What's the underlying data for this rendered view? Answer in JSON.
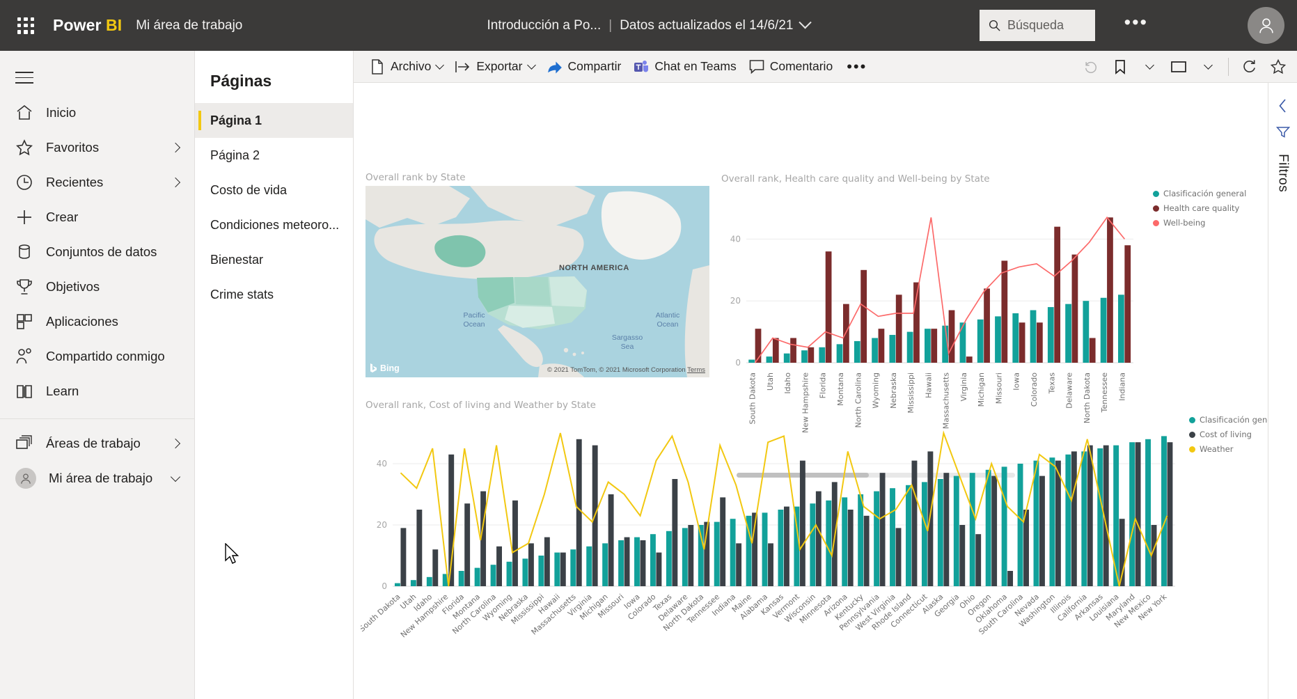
{
  "header": {
    "brand_power": "Power ",
    "brand_bi": "BI",
    "workspace": "Mi área de trabajo",
    "report_title": "Introducción a Po...",
    "separator": "|",
    "refresh_status": "Datos actualizados el 14/6/21",
    "search_placeholder": "Búsqueda",
    "more_options": "•••",
    "waffle_icon": "app-launcher-icon",
    "search_icon": "search-icon",
    "account_icon": "account-avatar-icon",
    "chevron_icon": "chevron-down-icon"
  },
  "sidebar": {
    "hamburger_icon": "hamburger-menu-icon",
    "items": [
      {
        "label": "Inicio",
        "icon": "home-icon",
        "expandable": false
      },
      {
        "label": "Favoritos",
        "icon": "star-icon",
        "expandable": true
      },
      {
        "label": "Recientes",
        "icon": "clock-icon",
        "expandable": true
      },
      {
        "label": "Crear",
        "icon": "plus-icon",
        "expandable": false
      },
      {
        "label": "Conjuntos de datos",
        "icon": "dataset-cylinder-icon",
        "expandable": false
      },
      {
        "label": "Objetivos",
        "icon": "trophy-icon",
        "expandable": false
      },
      {
        "label": "Aplicaciones",
        "icon": "apps-grid-icon",
        "expandable": false
      },
      {
        "label": "Compartido conmigo",
        "icon": "shared-people-icon",
        "expandable": false
      },
      {
        "label": "Learn",
        "icon": "book-icon",
        "expandable": false
      }
    ],
    "workspaces": [
      {
        "label": "Áreas de trabajo",
        "icon": "workspaces-stack-icon",
        "expandable": true
      },
      {
        "label": "Mi área de trabajo",
        "icon": "my-workspace-avatar-icon",
        "expandable": true
      }
    ]
  },
  "pages_pane": {
    "title": "Páginas",
    "collapse_icon": "double-chevron-left-icon",
    "pages": [
      {
        "label": "Página 1",
        "active": true
      },
      {
        "label": "Página 2",
        "active": false
      },
      {
        "label": "Costo de vida",
        "active": false
      },
      {
        "label": "Condiciones meteoro...",
        "active": false
      },
      {
        "label": "Bienestar",
        "active": false
      },
      {
        "label": "Crime stats",
        "active": false
      }
    ]
  },
  "toolbar": {
    "items": [
      {
        "label": "Archivo",
        "icon": "file-icon",
        "has_chevron": true
      },
      {
        "label": "Exportar",
        "icon": "export-arrow-icon",
        "has_chevron": true
      },
      {
        "label": "Compartir",
        "icon": "share-icon",
        "has_chevron": false
      },
      {
        "label": "Chat en Teams",
        "icon": "teams-icon",
        "has_chevron": false
      },
      {
        "label": "Comentario",
        "icon": "comment-bubble-icon",
        "has_chevron": false
      }
    ],
    "more_label": "•••",
    "right_icons": [
      {
        "name": "reset-icon",
        "has_chevron": false
      },
      {
        "name": "bookmark-icon",
        "has_chevron": true
      },
      {
        "name": "view-icon",
        "has_chevron": true
      },
      {
        "name": "refresh-icon",
        "has_chevron": false
      },
      {
        "name": "favorite-star-icon",
        "has_chevron": false
      }
    ]
  },
  "filters_pane": {
    "expand_icon": "chevron-left-icon",
    "filter_icon": "filter-funnel-icon",
    "label": "Filtros"
  },
  "map_visual": {
    "title": "Overall rank by State",
    "provider": "Bing",
    "provider_icon": "bing-logo-icon",
    "credit": "© 2021 TomTom, © 2021 Microsoft Corporation",
    "credit_link": "Terms",
    "continent_label": "NORTH AMERICA",
    "ocean_labels": [
      "Pacific Ocean",
      "Atlantic Ocean",
      "Sargasso Sea"
    ]
  },
  "chart_data": [
    {
      "id": "chart-health",
      "type": "bar",
      "title": "Overall rank, Health care quality and Well-being by State",
      "xlabel": "",
      "ylabel": "",
      "ylim": [
        0,
        50
      ],
      "yticks": [
        0,
        20,
        40
      ],
      "grid": true,
      "legend_position": "right",
      "categories": [
        "South Dakota",
        "Utah",
        "Idaho",
        "New Hampshire",
        "Florida",
        "Montana",
        "North Carolina",
        "Wyoming",
        "Nebraska",
        "Mississippi",
        "Hawaii",
        "Massachusetts",
        "Virginia",
        "Michigan",
        "Missouri",
        "Iowa",
        "Colorado",
        "Texas",
        "Delaware",
        "North Dakota",
        "Tennessee",
        "Indiana"
      ],
      "series": [
        {
          "name": "Clasificación general",
          "type": "bar",
          "color": "#12a19a",
          "values": [
            1,
            2,
            3,
            4,
            5,
            6,
            7,
            8,
            9,
            10,
            11,
            12,
            13,
            14,
            15,
            16,
            17,
            18,
            19,
            20,
            21,
            22
          ]
        },
        {
          "name": "Health care quality",
          "type": "bar",
          "color": "#7b2c2c",
          "values": [
            11,
            8,
            8,
            5,
            36,
            19,
            30,
            11,
            22,
            26,
            11,
            17,
            2,
            24,
            33,
            13,
            13,
            44,
            35,
            8,
            47,
            38
          ]
        },
        {
          "name": "Well-being",
          "type": "line",
          "color": "#fc6a6a",
          "values": [
            0,
            8,
            6,
            5,
            10,
            8,
            19,
            15,
            16,
            16,
            47,
            3,
            14,
            23,
            29,
            31,
            32,
            28,
            33,
            39,
            47,
            40
          ]
        }
      ]
    },
    {
      "id": "chart-cost-weather",
      "type": "bar",
      "title": "Overall rank, Cost of living and Weather by State",
      "xlabel": "",
      "ylabel": "",
      "ylim": [
        0,
        50
      ],
      "yticks": [
        0,
        20,
        40
      ],
      "grid": true,
      "legend_position": "right",
      "categories": [
        "South Dakota",
        "Utah",
        "Idaho",
        "New Hampshire",
        "Florida",
        "Montana",
        "North Carolina",
        "Wyoming",
        "Nebraska",
        "Mississippi",
        "Hawaii",
        "Massachusetts",
        "Virginia",
        "Michigan",
        "Missouri",
        "Iowa",
        "Colorado",
        "Texas",
        "Delaware",
        "North Dakota",
        "Tennessee",
        "Indiana",
        "Maine",
        "Alabama",
        "Kansas",
        "Vermont",
        "Wisconsin",
        "Minnesota",
        "Arizona",
        "Kentucky",
        "Pennsylvania",
        "West Virginia",
        "Rhode Island",
        "Connecticut",
        "Alaska",
        "Georgia",
        "Ohio",
        "Oregon",
        "Oklahoma",
        "South Carolina",
        "Nevada",
        "Washington",
        "Illinois",
        "California",
        "Arkansas",
        "Louisiana",
        "Maryland",
        "New Mexico",
        "New York"
      ],
      "series": [
        {
          "name": "Clasificación general",
          "type": "bar",
          "color": "#12a19a",
          "values": [
            1,
            2,
            3,
            4,
            5,
            6,
            7,
            8,
            9,
            10,
            11,
            12,
            13,
            14,
            15,
            16,
            17,
            18,
            19,
            20,
            21,
            22,
            23,
            24,
            25,
            26,
            27,
            28,
            29,
            30,
            31,
            32,
            33,
            34,
            35,
            36,
            37,
            38,
            39,
            40,
            41,
            42,
            43,
            44,
            45,
            46,
            47,
            48,
            49
          ]
        },
        {
          "name": "Cost of living",
          "type": "bar",
          "color": "#3b4147",
          "values": [
            19,
            25,
            12,
            43,
            27,
            31,
            13,
            28,
            14,
            16,
            11,
            48,
            46,
            30,
            16,
            15,
            11,
            35,
            20,
            21,
            29,
            14,
            24,
            14,
            26,
            41,
            31,
            34,
            25,
            23,
            37,
            19,
            41,
            44,
            37,
            20,
            17,
            36,
            5,
            25,
            36,
            41,
            44,
            46,
            46,
            22,
            47,
            20,
            47
          ]
        },
        {
          "name": "Weather",
          "type": "line",
          "color": "#f2c811",
          "values": [
            37,
            32,
            45,
            0,
            45,
            15,
            46,
            11,
            14,
            30,
            50,
            26,
            21,
            34,
            30,
            23,
            41,
            49,
            34,
            12,
            46,
            33,
            14,
            47,
            49,
            12,
            20,
            10,
            44,
            26,
            22,
            25,
            33,
            18,
            50,
            36,
            22,
            40,
            26,
            21,
            43,
            39,
            28,
            48,
            24,
            0,
            22,
            10,
            23
          ]
        }
      ]
    }
  ],
  "legends": {
    "chart1": [
      {
        "label": "Clasificación general",
        "color": "#12a19a"
      },
      {
        "label": "Health care quality",
        "color": "#7b2c2c"
      },
      {
        "label": "Well-being",
        "color": "#fc6a6a"
      }
    ],
    "chart2": [
      {
        "label": "Clasificación general",
        "color": "#12a19a"
      },
      {
        "label": "Cost of living",
        "color": "#3b4147"
      },
      {
        "label": "Weather",
        "color": "#f2c811"
      }
    ]
  },
  "colors": {
    "header_bg": "#3b3a39",
    "accent_yellow": "#f2c811",
    "teal": "#12a19a",
    "dark_red": "#7b2c2c",
    "salmon": "#fc6a6a",
    "dark_slate": "#3b4147"
  }
}
